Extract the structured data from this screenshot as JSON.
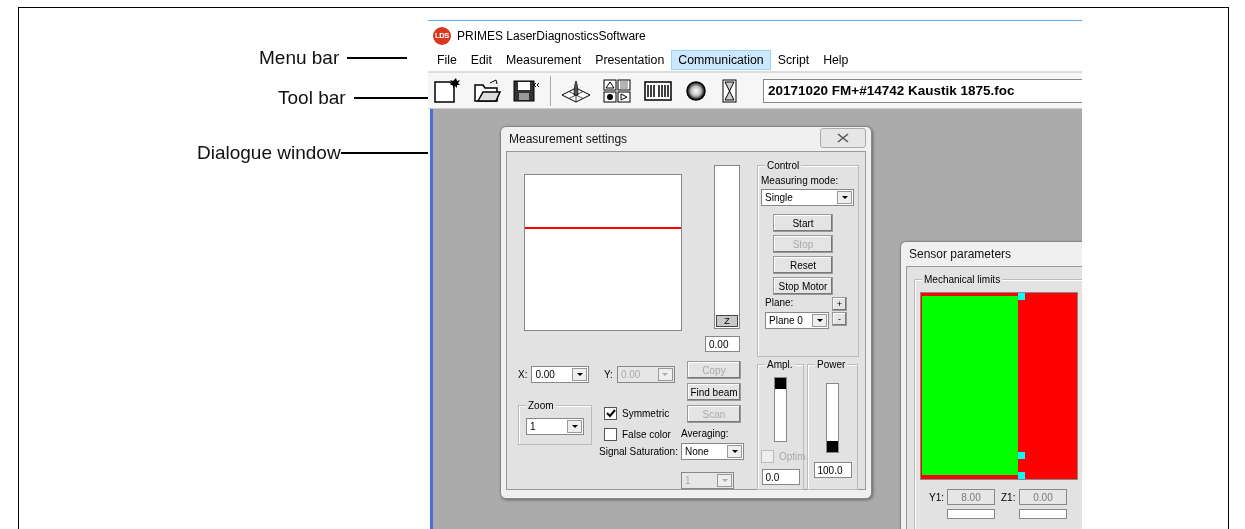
{
  "annotations": [
    {
      "label": "Menu bar"
    },
    {
      "label": "Tool bar"
    },
    {
      "label": "Dialogue window"
    }
  ],
  "app": {
    "logo_text": "LDS",
    "title": "PRIMES LaserDiagnosticsSoftware"
  },
  "menu": [
    {
      "label": "File",
      "selected": false
    },
    {
      "label": "Edit",
      "selected": false
    },
    {
      "label": "Measurement",
      "selected": false
    },
    {
      "label": "Presentation",
      "selected": false
    },
    {
      "label": "Communication",
      "selected": true
    },
    {
      "label": "Script",
      "selected": false
    },
    {
      "label": "Help",
      "selected": false
    }
  ],
  "toolbar": {
    "file_field": "20171020 FM+#14742 Kaustik 1875.foc"
  },
  "measurement_settings": {
    "title": "Measurement settings",
    "z_label": "Z",
    "z_value": "0.00",
    "x_label": "X:",
    "x_value": "0.00",
    "y_label": "Y:",
    "y_value": "0.00",
    "y_disabled": true,
    "zoom": {
      "title": "Zoom",
      "value": "1"
    },
    "checkboxes": [
      {
        "label": "Symmetric",
        "checked": true
      },
      {
        "label": "False color",
        "checked": false
      }
    ],
    "signal_saturation_label": "Signal Saturation:",
    "signal_saturation_value": "1",
    "signal_saturation_disabled": true,
    "action_buttons": [
      {
        "label": "Copy",
        "disabled": true
      },
      {
        "label": "Find beam",
        "disabled": false
      },
      {
        "label": "Scan",
        "disabled": true
      }
    ],
    "averaging_label": "Averaging:",
    "averaging_value": "None",
    "control": {
      "title": "Control",
      "mode_label": "Measuring mode:",
      "mode_value": "Single",
      "buttons": [
        {
          "label": "Start",
          "disabled": false
        },
        {
          "label": "Stop",
          "disabled": true
        },
        {
          "label": "Reset",
          "disabled": false
        },
        {
          "label": "Stop Motor",
          "disabled": false
        }
      ],
      "plane_label": "Plane:",
      "plane_value": "Plane 0",
      "plus": "+",
      "minus": "-"
    },
    "ampl": {
      "title": "Ampl.",
      "level": 1,
      "optim": {
        "label": "Optim.",
        "checked": false,
        "disabled": true
      },
      "value": "0.0"
    },
    "power": {
      "title": "Power",
      "level": 0,
      "value": "100.0"
    }
  },
  "sensor_parameters": {
    "title": "Sensor parameters",
    "group": "Mechanical limits",
    "fields": [
      {
        "label": "Y1:",
        "value": "8.00",
        "disabled": true
      },
      {
        "label": "Z1:",
        "value": "0.00",
        "disabled": true
      }
    ]
  }
}
